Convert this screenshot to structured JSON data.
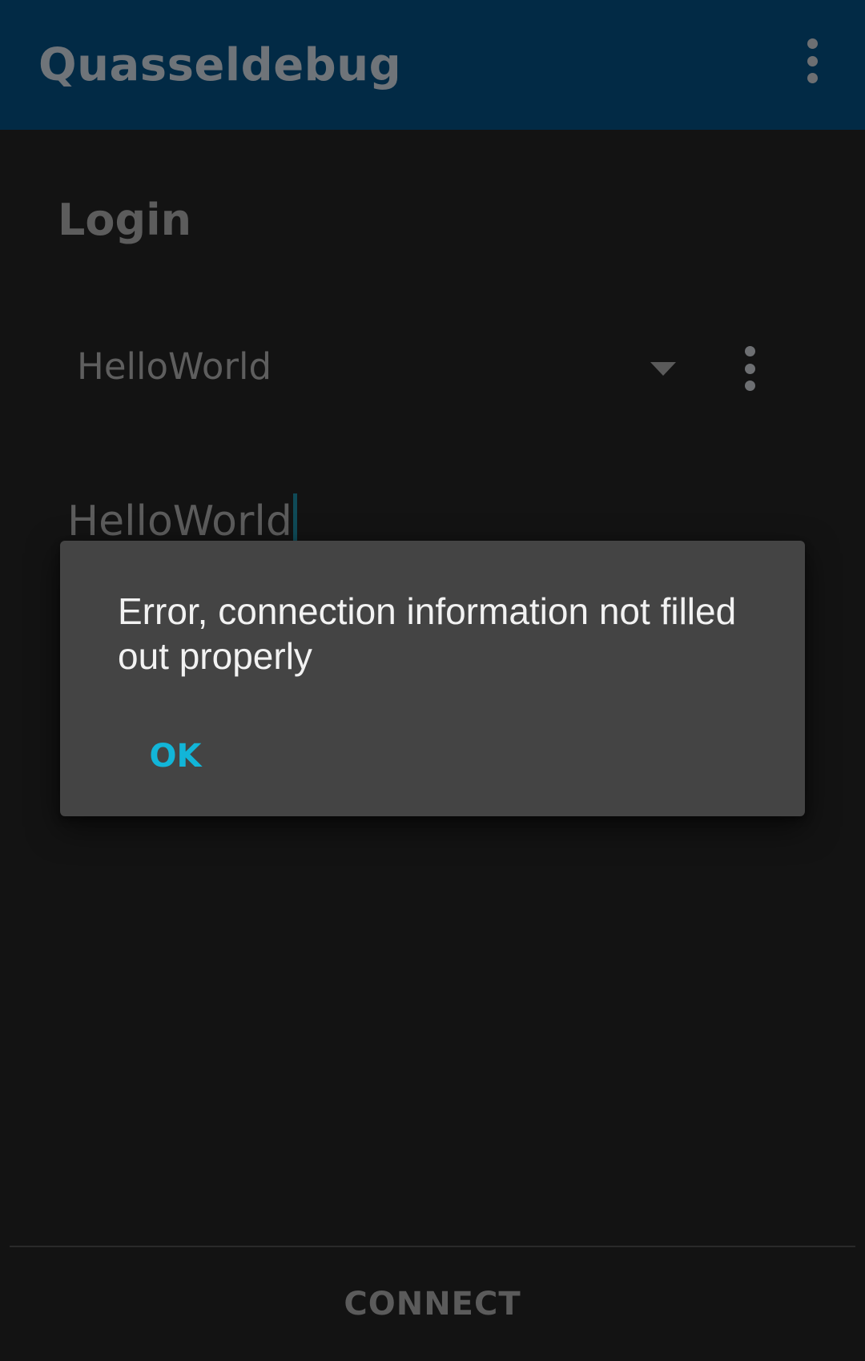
{
  "app_bar": {
    "title": "Quasseldebug",
    "menu_icon": "more-vert-icon",
    "background_color": "#022a45"
  },
  "login": {
    "heading": "Login",
    "account_spinner": {
      "selected": "HelloWorld",
      "dropdown_icon": "dropdown-arrow-icon",
      "menu_icon": "more-vert-icon"
    },
    "username_field": {
      "value": "HelloWorld"
    }
  },
  "bottom_bar": {
    "connect_label": "CONNECT"
  },
  "dialog": {
    "message": "Error, connection information not filled out properly",
    "ok_label": "OK",
    "accent_color": "#12b5d8",
    "background_color": "#444444"
  }
}
